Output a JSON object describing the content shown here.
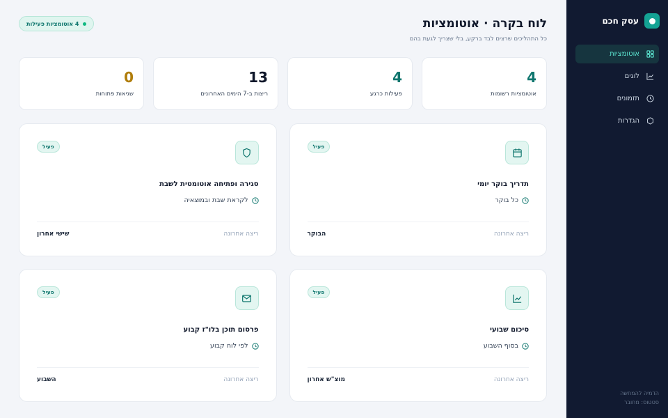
{
  "sidebar": {
    "brand": "עסק חכם",
    "items": [
      {
        "label": "אוטומציות",
        "icon": "grid-icon",
        "active": true
      },
      {
        "label": "לוגים",
        "icon": "chart-line-icon",
        "active": false
      },
      {
        "label": "תזמונים",
        "icon": "clock-icon",
        "active": false
      },
      {
        "label": "הגדרות",
        "icon": "hexagon-icon",
        "active": false
      }
    ],
    "footer_line1": "הדמיה להמחשה",
    "footer_line2": "סטטוס: מחובר"
  },
  "header": {
    "title": "לוח בקרה · אוטומציות",
    "subtitle": "כל התהליכים שרצים לבד ברקע, בלי שצריך לגעת בהם",
    "pill": "4 אוטומציות פעילות"
  },
  "stats": [
    {
      "value": "4",
      "label": "אוטומציות רשומות",
      "color": "#0f766e"
    },
    {
      "value": "4",
      "label": "פעילות כרגע",
      "color": "#0f766e"
    },
    {
      "value": "13",
      "label": "ריצות ב-7 הימים האחרונים",
      "color": "#0f172a"
    },
    {
      "value": "0",
      "label": "שגיאות פתוחות",
      "color": "#b07d0b"
    }
  ],
  "cards": [
    {
      "title": "תדריך בוקר יומי",
      "schedule": "כל בוקר",
      "status": "פעיל",
      "last_label": "ריצה אחרונה",
      "last_value": "הבוקר",
      "icon": "calendar-icon"
    },
    {
      "title": "סגירה ופתיחה אוטומטית לשבת",
      "schedule": "לקראת שבת ובמוצאיה",
      "status": "פעיל",
      "last_label": "ריצה אחרונה",
      "last_value": "שישי אחרון",
      "icon": "shield-icon"
    },
    {
      "title": "סיכום שבועי",
      "schedule": "בסוף השבוע",
      "status": "פעיל",
      "last_label": "ריצה אחרונה",
      "last_value": "מוצ\"ש אחרון",
      "icon": "chart-line-icon"
    },
    {
      "title": "פרסום תוכן בלו\"ז קבוע",
      "schedule": "לפי לוח קבוע",
      "status": "פעיל",
      "last_label": "ריצה אחרונה",
      "last_value": "השבוע",
      "icon": "mail-icon"
    }
  ],
  "colors": {
    "accent": "#0f766e",
    "sidebar_bg": "#111a31",
    "brand": "#14a394",
    "warning": "#b07d0b"
  }
}
